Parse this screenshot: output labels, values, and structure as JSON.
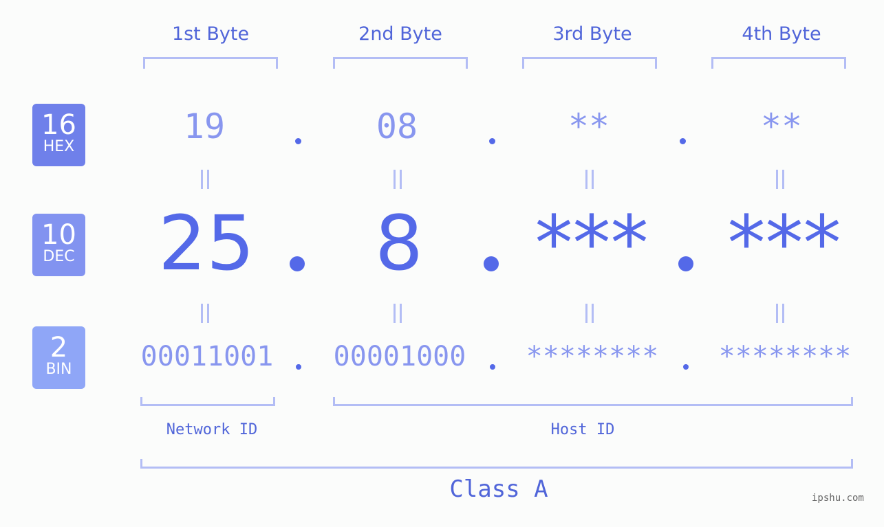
{
  "byte_headers": [
    "1st Byte",
    "2nd Byte",
    "3rd Byte",
    "4th Byte"
  ],
  "badges": {
    "hex": {
      "number": "16",
      "label": "HEX",
      "color": "#6f80ea"
    },
    "dec": {
      "number": "10",
      "label": "DEC",
      "color": "#8293f0"
    },
    "bin": {
      "number": "2",
      "label": "BIN",
      "color": "#8fa6f7"
    }
  },
  "hex_values": [
    "19",
    "08",
    "**",
    "**"
  ],
  "dec_values": [
    "25",
    "8",
    "***",
    "***"
  ],
  "bin_values": [
    "00011001",
    "00001000",
    "********",
    "********"
  ],
  "separator": ".",
  "network_id_label": "Network ID",
  "host_id_label": "Host ID",
  "class_label": "Class A",
  "watermark": "ipshu.com",
  "colors": {
    "accent": "#5469e8",
    "light_value": "#8896ef",
    "bracket": "#b3bdf5",
    "background": "#fbfcfb"
  }
}
